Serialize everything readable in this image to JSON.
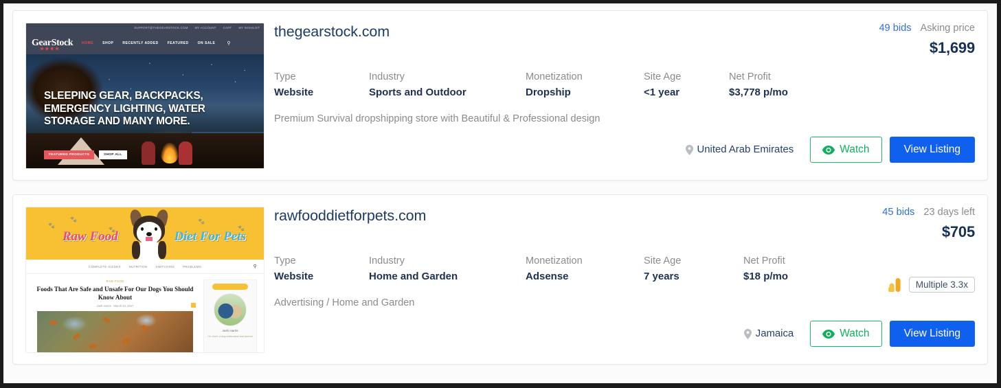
{
  "listings": [
    {
      "id": "thegearstock",
      "domain": "thegearstock.com",
      "bids": "49 bids",
      "price_label": "Asking price",
      "price": "$1,699",
      "specs": [
        {
          "label": "Type",
          "value": "Website"
        },
        {
          "label": "Industry",
          "value": "Sports and Outdoor"
        },
        {
          "label": "Monetization",
          "value": "Dropship"
        },
        {
          "label": "Site Age",
          "value": "<1 year"
        },
        {
          "label": "Net Profit",
          "value": "$3,778 p/mo"
        }
      ],
      "description": "Premium Survival dropshipping store with Beautiful & Professional design",
      "location": "United Arab Emirates",
      "watch_label": "Watch",
      "view_label": "View Listing",
      "multiple_badge": null,
      "thumbnail": {
        "kind": "gearstock",
        "topbar_items": [
          "SUPPORT@THEGEARSTOCK.COM",
          "MY ACCOUNT",
          "CART",
          "MY WISHLIST"
        ],
        "logo": "GearStock",
        "stars": "★★★★",
        "nav": [
          "HOME",
          "SHOP",
          "RECENTLY ADDED",
          "FEATURED",
          "ON SALE"
        ],
        "hero_heading": "SLEEPING GEAR, BACKPACKS, EMERGENCY LIGHTING, WATER STORAGE AND MANY MORE.",
        "hero_btn_primary": "FEATURED PRODUCTS",
        "hero_btn_secondary": "SHOP ALL"
      }
    },
    {
      "id": "rawfooddietforpets",
      "domain": "rawfooddietforpets.com",
      "bids": "45 bids",
      "price_label": "23 days left",
      "price": "$705",
      "specs": [
        {
          "label": "Type",
          "value": "Website"
        },
        {
          "label": "Industry",
          "value": "Home and Garden"
        },
        {
          "label": "Monetization",
          "value": "Adsense"
        },
        {
          "label": "Site Age",
          "value": "7 years"
        },
        {
          "label": "Net Profit",
          "value": "$18 p/mo"
        }
      ],
      "description": "Advertising / Home and Garden",
      "location": "Jamaica",
      "watch_label": "Watch",
      "view_label": "View Listing",
      "multiple_badge": "Multiple 3.3x",
      "thumbnail": {
        "kind": "rawfood",
        "title_left": "Raw Food",
        "title_right": "Diet For Pets",
        "nav": [
          "COMPLETE GUIDES",
          "NUTRITION",
          "SWITCHING",
          "PROBLEMS"
        ],
        "post_category": "RAW FOOD",
        "post_title": "Foods That Are Safe and Unsafe For Our Dogs You Should Know About",
        "post_meta": "Josh Harris  ·  March 10, 2017",
        "sidebar_name": "Josh Harris",
        "sidebar_sub": "I'm Josh, a dog enthusiast and animal"
      }
    }
  ],
  "icons": {
    "eye": "eye-icon",
    "pin": "map-pin-icon",
    "analytics": "google-analytics-icon",
    "search": "search-icon"
  },
  "colors": {
    "link_blue": "#2f6fd8",
    "button_blue": "#1060ef",
    "watch_green": "#11b05f",
    "title_navy": "#1d3c63",
    "muted_gray": "#8b8b8b"
  }
}
